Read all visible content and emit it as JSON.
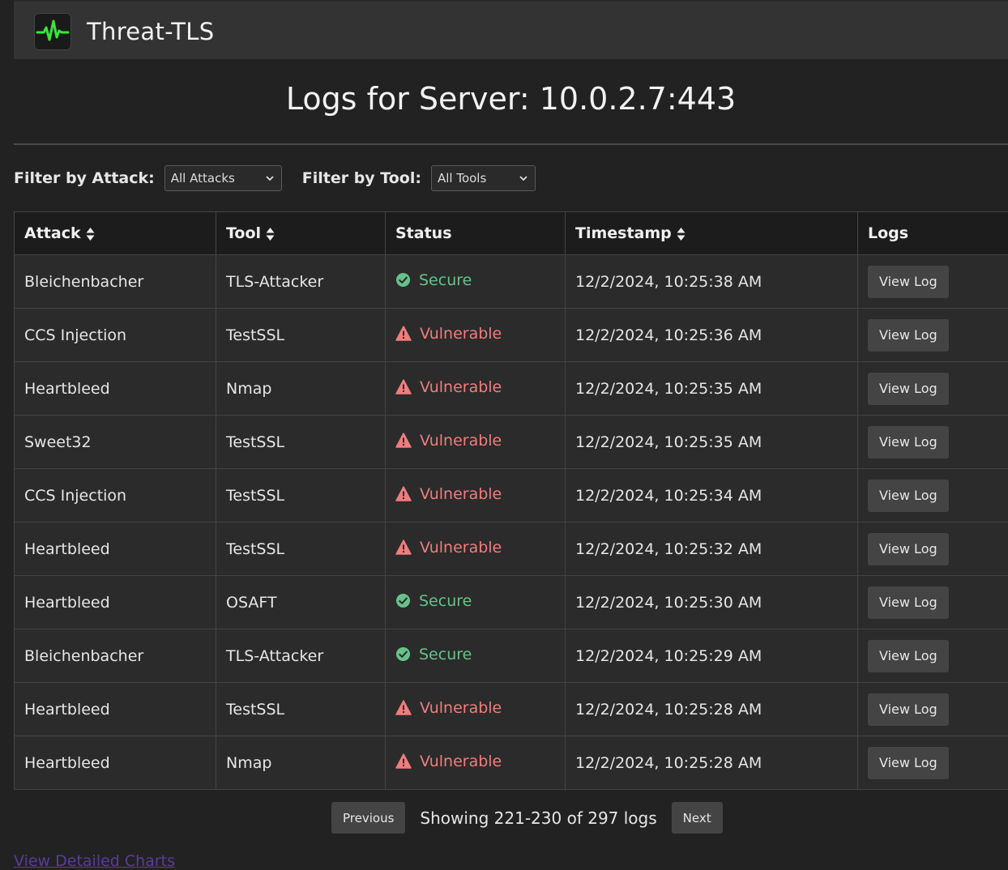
{
  "navbar": {
    "brand": "Threat-TLS"
  },
  "page_title": "Logs for Server: 10.0.2.7:443",
  "filters": {
    "attack_label": "Filter by Attack:",
    "attack_value": "All Attacks",
    "tool_label": "Filter by Tool:",
    "tool_value": "All Tools"
  },
  "table": {
    "headers": [
      "Attack",
      "Tool",
      "Status",
      "Timestamp",
      "Logs"
    ],
    "rows": [
      {
        "attack": "Bleichenbacher",
        "tool": "TLS-Attacker",
        "status": "Secure",
        "timestamp": "12/2/2024, 10:25:38 AM",
        "action": "View Log"
      },
      {
        "attack": "CCS Injection",
        "tool": "TestSSL",
        "status": "Vulnerable",
        "timestamp": "12/2/2024, 10:25:36 AM",
        "action": "View Log"
      },
      {
        "attack": "Heartbleed",
        "tool": "Nmap",
        "status": "Vulnerable",
        "timestamp": "12/2/2024, 10:25:35 AM",
        "action": "View Log"
      },
      {
        "attack": "Sweet32",
        "tool": "TestSSL",
        "status": "Vulnerable",
        "timestamp": "12/2/2024, 10:25:35 AM",
        "action": "View Log"
      },
      {
        "attack": "CCS Injection",
        "tool": "TestSSL",
        "status": "Vulnerable",
        "timestamp": "12/2/2024, 10:25:34 AM",
        "action": "View Log"
      },
      {
        "attack": "Heartbleed",
        "tool": "TestSSL",
        "status": "Vulnerable",
        "timestamp": "12/2/2024, 10:25:32 AM",
        "action": "View Log"
      },
      {
        "attack": "Heartbleed",
        "tool": "OSAFT",
        "status": "Secure",
        "timestamp": "12/2/2024, 10:25:30 AM",
        "action": "View Log"
      },
      {
        "attack": "Bleichenbacher",
        "tool": "TLS-Attacker",
        "status": "Secure",
        "timestamp": "12/2/2024, 10:25:29 AM",
        "action": "View Log"
      },
      {
        "attack": "Heartbleed",
        "tool": "TestSSL",
        "status": "Vulnerable",
        "timestamp": "12/2/2024, 10:25:28 AM",
        "action": "View Log"
      },
      {
        "attack": "Heartbleed",
        "tool": "Nmap",
        "status": "Vulnerable",
        "timestamp": "12/2/2024, 10:25:28 AM",
        "action": "View Log"
      }
    ]
  },
  "pagination": {
    "previous": "Previous",
    "summary": "Showing 221-230 of 297 logs",
    "next": "Next"
  },
  "bottom_link": "View Detailed Charts",
  "colors": {
    "secure": "#66c28a",
    "vulnerable": "#ef7d7d",
    "logo_pulse": "#39e639"
  }
}
